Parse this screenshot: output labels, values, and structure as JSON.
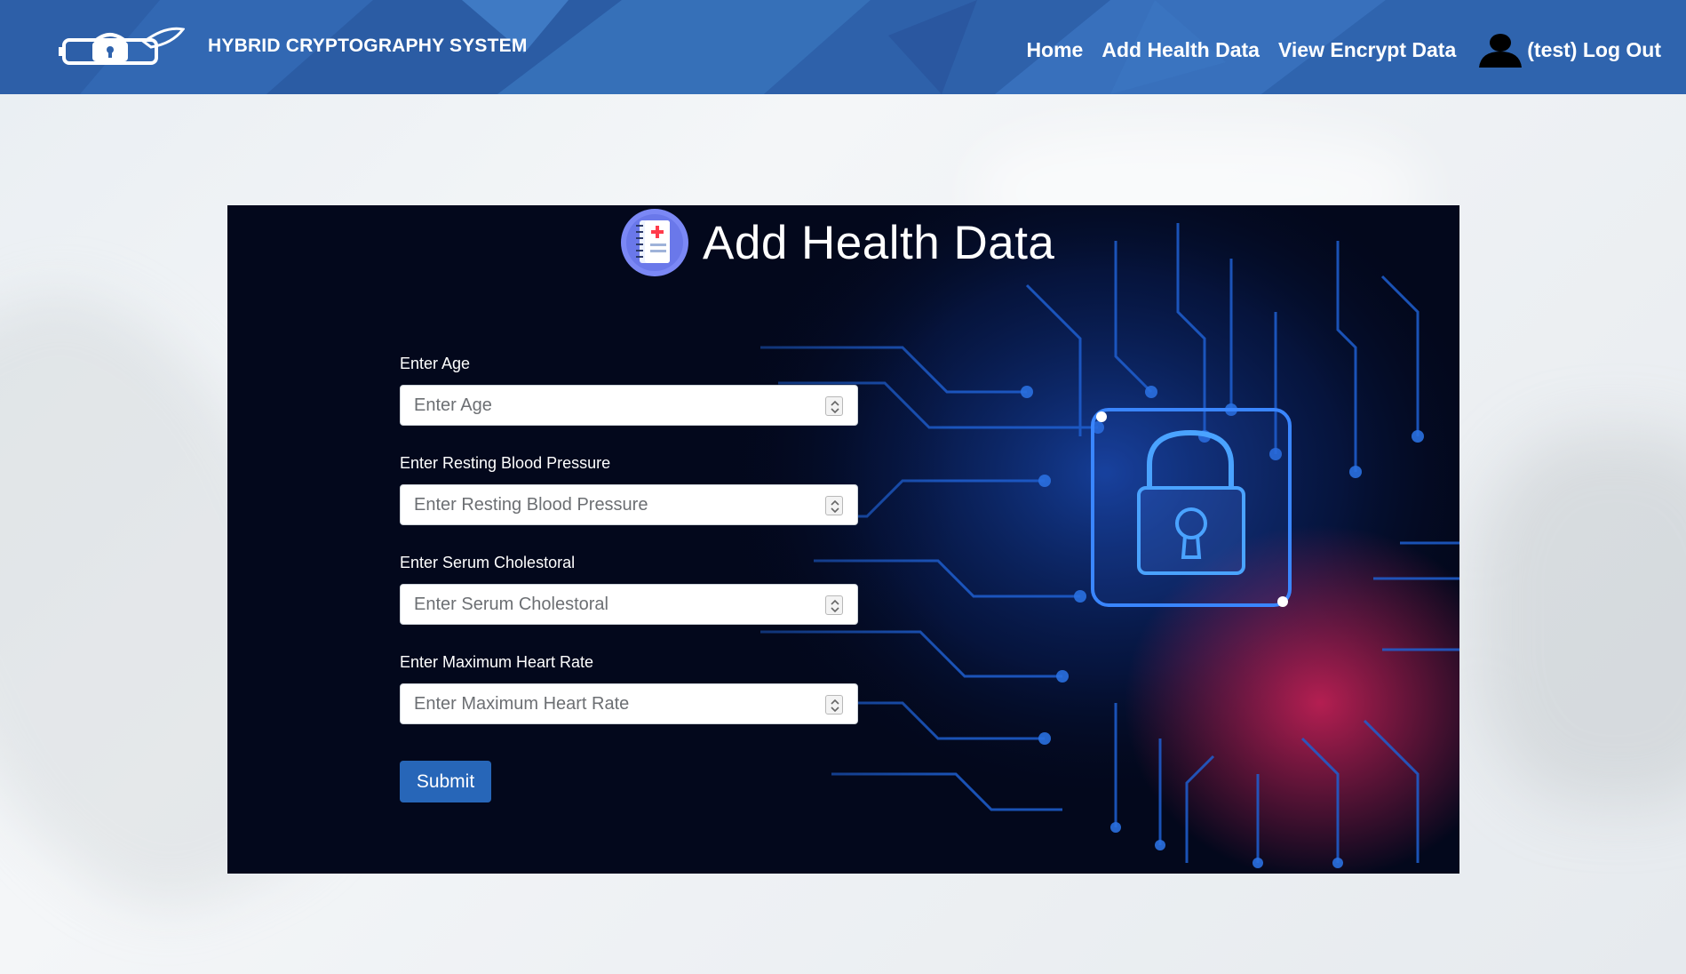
{
  "navbar": {
    "brand_title": "HYBRID CRYPTOGRAPHY SYSTEM",
    "links": [
      "Home",
      "Add Health Data",
      "View Encrypt Data"
    ],
    "logout_label": "(test) Log Out",
    "background_color": "#2f63ae"
  },
  "panel": {
    "title": "Add Health Data",
    "fields": [
      {
        "label": "Enter Age",
        "placeholder": "Enter Age",
        "value": ""
      },
      {
        "label": "Enter Resting Blood Pressure",
        "placeholder": "Enter Resting Blood Pressure",
        "value": ""
      },
      {
        "label": "Enter Serum Cholestoral",
        "placeholder": "Enter Serum Cholestoral",
        "value": ""
      },
      {
        "label": "Enter Maximum Heart Rate",
        "placeholder": "Enter Maximum Heart Rate",
        "value": ""
      }
    ],
    "submit_label": "Submit",
    "submit_color": "#2766b8"
  },
  "icons": {
    "brand": "lock-key-logo-icon",
    "user": "user-silhouette-icon",
    "title": "health-record-icon",
    "spinner": "number-spinner-icon",
    "illustration": "padlock-circuit-icon"
  }
}
